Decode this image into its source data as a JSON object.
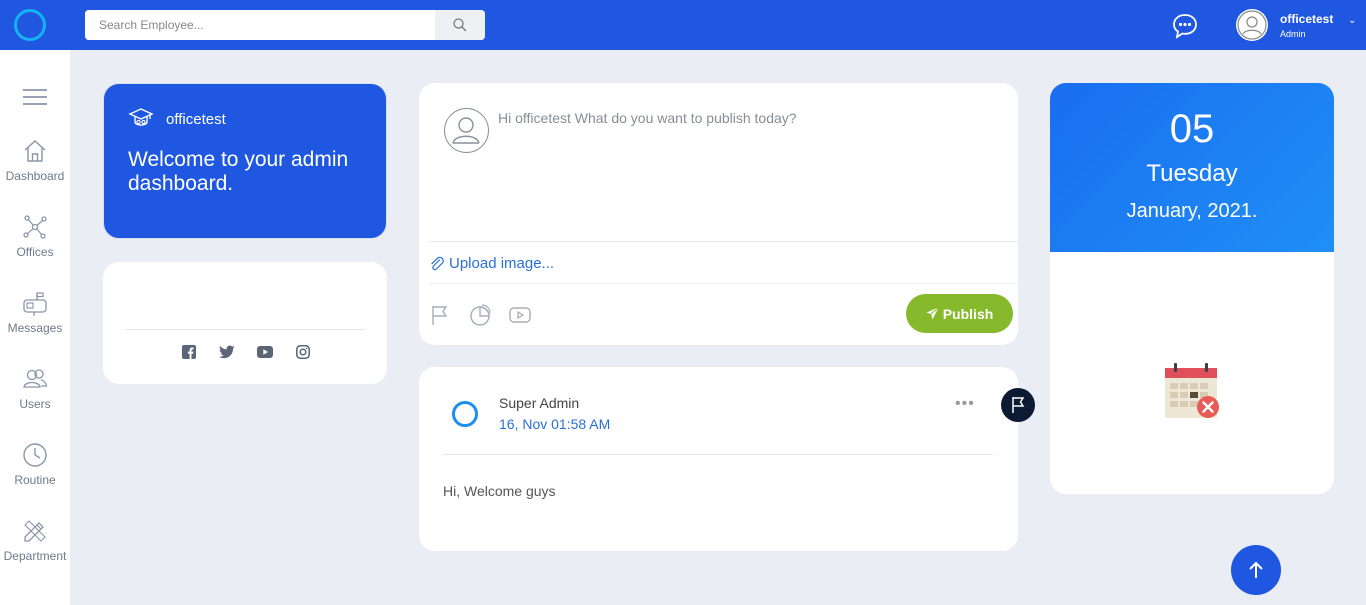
{
  "topbar": {
    "search_placeholder": "Search Employee...",
    "user_name": "officetest",
    "user_role": "Admin"
  },
  "sidebar": {
    "items": [
      {
        "label": "Dashboard",
        "icon": "home-icon"
      },
      {
        "label": "Offices",
        "icon": "network-icon"
      },
      {
        "label": "Messages",
        "icon": "mailbox-icon"
      },
      {
        "label": "Users",
        "icon": "users-icon"
      },
      {
        "label": "Routine",
        "icon": "clock-icon"
      },
      {
        "label": "Department",
        "icon": "pencil-ruler-icon"
      }
    ]
  },
  "welcome": {
    "brand": "officetest",
    "text": "Welcome to your admin dashboard."
  },
  "composer": {
    "prompt": "Hi officetest What do you want to publish today?",
    "upload_label": "Upload image...",
    "publish_label": "Publish"
  },
  "post": {
    "author": "Super Admin",
    "date": "16, Nov 01:58 AM",
    "text": "Hi, Welcome guys"
  },
  "calendar": {
    "day": "05",
    "weekday": "Tuesday",
    "month_year": "January, 2021."
  },
  "colors": {
    "primary": "#1f57e0",
    "publish": "#86b92c",
    "link": "#2a6fd9"
  }
}
